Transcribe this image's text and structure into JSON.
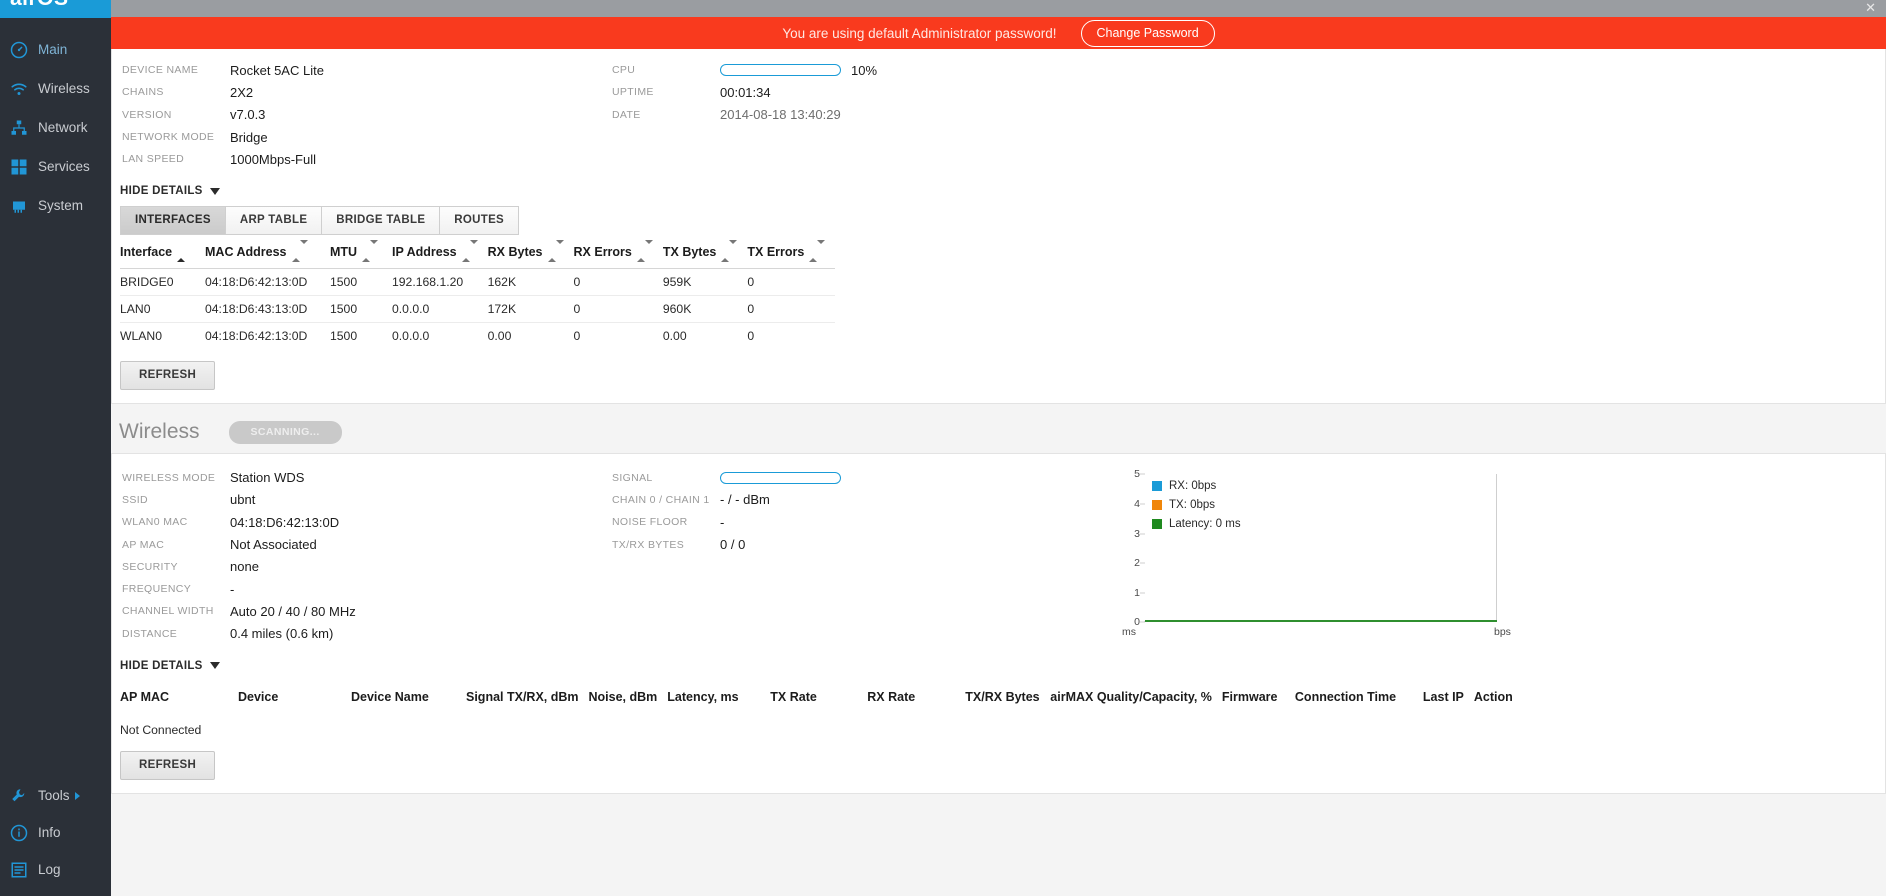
{
  "brand": {
    "logo": "airOS"
  },
  "window": {
    "close_label": "✕"
  },
  "alert": {
    "message": "You are using default Administrator password!",
    "button": "Change Password",
    "color": "#f93a1e"
  },
  "sidebar": {
    "items": [
      {
        "label": "Main",
        "icon": "gauge-icon",
        "active": true
      },
      {
        "label": "Wireless",
        "icon": "wifi-icon",
        "active": false
      },
      {
        "label": "Network",
        "icon": "network-icon",
        "active": false
      },
      {
        "label": "Services",
        "icon": "services-icon",
        "active": false
      },
      {
        "label": "System",
        "icon": "system-icon",
        "active": false
      }
    ],
    "bottom_items": [
      {
        "label": "Tools",
        "icon": "tools-icon",
        "has_caret": true
      },
      {
        "label": "Info",
        "icon": "info-icon",
        "has_caret": false
      },
      {
        "label": "Log",
        "icon": "log-icon",
        "has_caret": false
      }
    ]
  },
  "device": {
    "left": [
      {
        "key": "DEVICE NAME",
        "value": "Rocket 5AC Lite"
      },
      {
        "key": "CHAINS",
        "value": "2X2"
      },
      {
        "key": "VERSION",
        "value": "v7.0.3"
      },
      {
        "key": "NETWORK MODE",
        "value": "Bridge"
      },
      {
        "key": "LAN SPEED",
        "value": "1000Mbps-Full"
      }
    ],
    "cpu": {
      "key": "CPU",
      "percent": 10,
      "percent_label": "10%"
    },
    "uptime": {
      "key": "UPTIME",
      "value": "00:01:34"
    },
    "date": {
      "key": "DATE",
      "value": "2014-08-18 13:40:29"
    }
  },
  "details_toggle": {
    "label": "HIDE DETAILS",
    "icon": "chevron-down-icon"
  },
  "interfaces": {
    "tabs": [
      {
        "label": "INTERFACES",
        "active": true
      },
      {
        "label": "ARP TABLE",
        "active": false
      },
      {
        "label": "BRIDGE TABLE",
        "active": false
      },
      {
        "label": "ROUTES",
        "active": false
      }
    ],
    "columns": [
      {
        "label": "Interface",
        "sort": "asc"
      },
      {
        "label": "MAC Address",
        "sort": "none"
      },
      {
        "label": "MTU",
        "sort": "none"
      },
      {
        "label": "IP Address",
        "sort": "none"
      },
      {
        "label": "RX Bytes",
        "sort": "none"
      },
      {
        "label": "RX Errors",
        "sort": "none"
      },
      {
        "label": "TX Bytes",
        "sort": "none"
      },
      {
        "label": "TX Errors",
        "sort": "none"
      }
    ],
    "rows": [
      [
        "BRIDGE0",
        "04:18:D6:42:13:0D",
        "1500",
        "192.168.1.20",
        "162K",
        "0",
        "959K",
        "0"
      ],
      [
        "LAN0",
        "04:18:D6:43:13:0D",
        "1500",
        "0.0.0.0",
        "172K",
        "0",
        "960K",
        "0"
      ],
      [
        "WLAN0",
        "04:18:D6:42:13:0D",
        "1500",
        "0.0.0.0",
        "0.00",
        "0",
        "0.00",
        "0"
      ]
    ],
    "refresh_label": "REFRESH"
  },
  "wireless": {
    "title": "Wireless",
    "status_pill": "SCANNING...",
    "left": [
      {
        "key": "WIRELESS MODE",
        "value": "Station WDS"
      },
      {
        "key": "SSID",
        "value": "ubnt"
      },
      {
        "key": "WLAN0 MAC",
        "value": "04:18:D6:42:13:0D"
      },
      {
        "key": "AP MAC",
        "value": "Not Associated"
      },
      {
        "key": "SECURITY",
        "value": "none"
      },
      {
        "key": "FREQUENCY",
        "value": "-"
      },
      {
        "key": "CHANNEL WIDTH",
        "value": "Auto 20 / 40 / 80 MHz"
      },
      {
        "key": "DISTANCE",
        "value": "0.4 miles (0.6 km)"
      }
    ],
    "signal": {
      "key": "SIGNAL",
      "percent": 0
    },
    "right": [
      {
        "key": "CHAIN 0 / CHAIN 1",
        "value": "- / - dBm"
      },
      {
        "key": "NOISE FLOOR",
        "value": "-"
      },
      {
        "key": "TX/RX BYTES",
        "value": "0 / 0"
      }
    ],
    "details_toggle": {
      "label": "HIDE DETAILS",
      "icon": "chevron-down-icon"
    },
    "stations": {
      "columns": [
        "AP MAC",
        "Device",
        "Device Name",
        "Signal TX/RX, dBm",
        "Noise, dBm",
        "Latency, ms",
        "TX Rate",
        "RX Rate",
        "TX/RX Bytes",
        "airMAX Quality/Capacity, %",
        "Firmware",
        "Connection Time",
        "Last IP",
        "Action"
      ],
      "empty_text": "Not Connected",
      "refresh_label": "REFRESH"
    }
  },
  "chart_data": {
    "type": "line",
    "title": "",
    "xlabel": "",
    "ylabel": "",
    "ylim": [
      0,
      5
    ],
    "yticks": [
      0,
      1,
      2,
      3,
      4,
      5
    ],
    "grid": false,
    "legend_position": "inside-top-left",
    "axis_note_left": "ms",
    "axis_note_right": "bps",
    "series": [
      {
        "name": "RX: 0bps",
        "color": "#1a9bd7",
        "values": [
          0,
          0,
          0,
          0,
          0,
          0,
          0,
          0,
          0,
          0
        ]
      },
      {
        "name": "TX: 0bps",
        "color": "#f0860a",
        "values": [
          0,
          0,
          0,
          0,
          0,
          0,
          0,
          0,
          0,
          0
        ]
      },
      {
        "name": "Latency: 0 ms",
        "color": "#1f8a1f",
        "values": [
          0,
          0,
          0,
          0,
          0,
          0,
          0,
          0,
          0,
          0
        ]
      }
    ]
  }
}
